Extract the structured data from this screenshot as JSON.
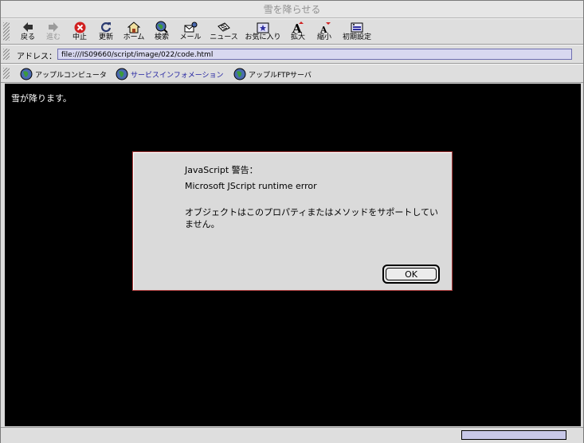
{
  "window": {
    "title": "雪を降らせる"
  },
  "toolbar": {
    "back": "戻る",
    "forward": "進む",
    "stop": "中止",
    "refresh": "更新",
    "home": "ホーム",
    "search": "検索",
    "mail": "メール",
    "news": "ニュース",
    "favorites": "お気に入り",
    "zoom_in": "拡大",
    "zoom_out": "縮小",
    "preferences": "初期設定"
  },
  "address": {
    "label": "アドレス：",
    "url": "file:///IS09660/script/image/022/code.html"
  },
  "favorites_bar": {
    "items": [
      "アップルコンピュータ",
      "サービスインフォメーション",
      "アップルFTPサーバ"
    ]
  },
  "page": {
    "text": "雪が降ります。"
  },
  "dialog": {
    "title": "JavaScript 警告：",
    "error": "Microsoft JScript runtime error",
    "message": "オブジェクトはこのプロパティまたはメソッドをサポートしていません。",
    "ok_label": "OK"
  },
  "status": {
    "progress": 1.0
  },
  "colors": {
    "content_bg": "#000000",
    "dialog_border": "#b04040",
    "address_bg": "#d8d8f0",
    "link": "#2020a0"
  }
}
